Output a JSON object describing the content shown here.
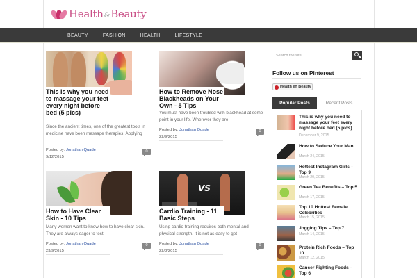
{
  "site": {
    "logo_main": "Health",
    "logo_amp": "&",
    "logo_second": "Beauty"
  },
  "nav": {
    "items": [
      "BEAUTY",
      "FASHION",
      "HEALTH",
      "LIFESTYLE"
    ]
  },
  "articles": [
    {
      "title": "This is why you need to massage your feet every night before bed (5 pics)",
      "excerpt": "Since the ancient times, one of the greatest tools in medicine have been message therapies. Applying",
      "posted_by_label": "Posted by:",
      "author": "Jonathan Quade",
      "date": "9/12/2015",
      "comments": "0",
      "thumb": "feet"
    },
    {
      "title": "How to Remove Nose Blackheads on Your Own - 5 Tips",
      "excerpt": "You must have been troubled with blackhead at some point in your life. Wherever they are",
      "posted_by_label": "Posted by:",
      "author": "Jonathan Quade",
      "date": "22/9/2015",
      "comments": "0",
      "thumb": "nose"
    },
    {
      "title": "How to Have Clear Skin - 10 Tips",
      "excerpt": "Many women want to know how to have clear skin. They are always eager to test",
      "posted_by_label": "Posted by:",
      "author": "Jonathan Quade",
      "date": "23/9/2015",
      "comments": "0",
      "thumb": "face"
    },
    {
      "title": "Cardio Training - 11 Basic Steps",
      "excerpt": "Using cardio training requires both mental and physical strength. It is not as easy to get",
      "posted_by_label": "Posted by:",
      "author": "Jonathan Quade",
      "date": "22/8/2015",
      "comments": "0",
      "thumb": "cardio"
    }
  ],
  "sidebar": {
    "search_placeholder": "Search the site",
    "follow_title": "Follow us on Pinterest",
    "pinterest_label": "Health en Beauty",
    "tabs": [
      "Popular Posts",
      "Recent Posts"
    ],
    "popular": [
      {
        "title": "This is why you need to massage your feet every night before bed (5 pics)",
        "date": "December 9, 2015",
        "thumb": "t1"
      },
      {
        "title": "How to Seduce Your Man",
        "date": "March 24, 2015",
        "thumb": "t2"
      },
      {
        "title": "Hottest Instagram Girls – Top 9",
        "date": "March 20, 2015",
        "thumb": "t3"
      },
      {
        "title": "Green Tea Benefits – Top 5",
        "date": "March 17, 2015",
        "thumb": "t4"
      },
      {
        "title": "Top 10 Hottest Female Celebrities",
        "date": "March 15, 2015",
        "thumb": "t5"
      },
      {
        "title": "Jogging Tips – Top 7",
        "date": "March 14, 2015",
        "thumb": "t6"
      },
      {
        "title": "Protein Rich Foods – Top 10",
        "date": "March 12, 2015",
        "thumb": "t7"
      },
      {
        "title": "Cancer Fighting Foods – Top 6",
        "date": "",
        "thumb": "t8"
      }
    ]
  }
}
